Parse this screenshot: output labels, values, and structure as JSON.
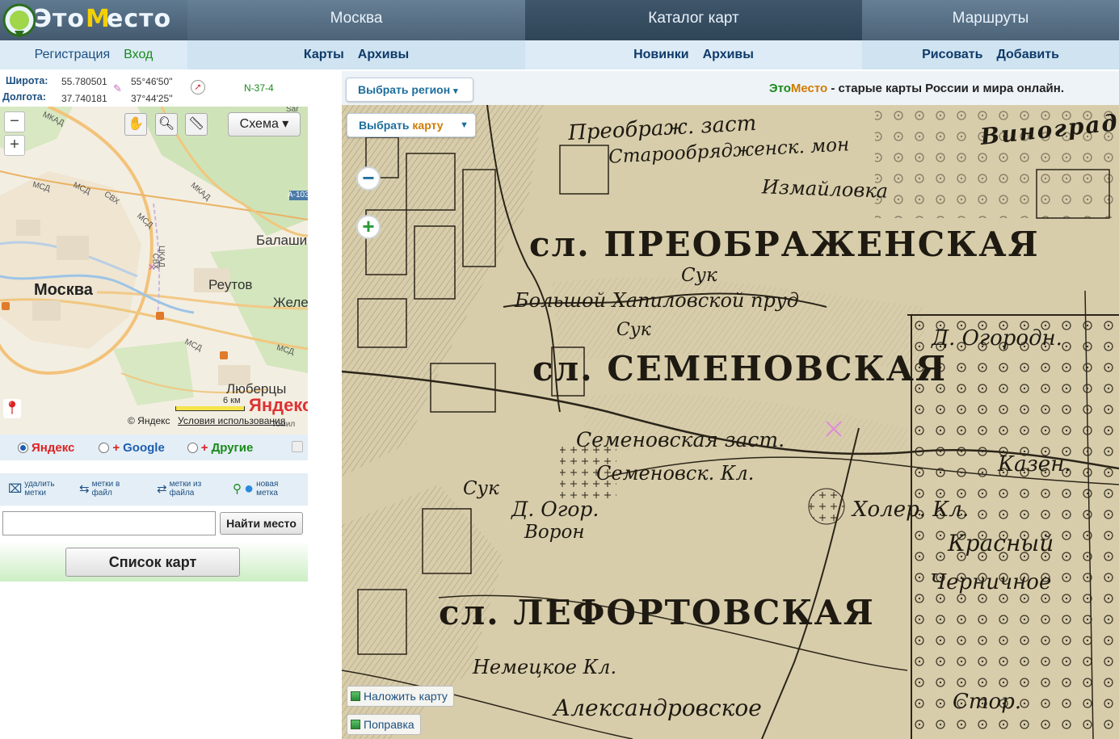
{
  "logo": {
    "text_eto": "Это",
    "text_m": "М",
    "text_esto": "есто"
  },
  "nav": {
    "tabs": [
      "Москва",
      "Каталог карт",
      "Маршруты"
    ]
  },
  "subnav": {
    "account": [
      "Регистрация",
      "Вход"
    ],
    "moscow": [
      "Карты",
      "Архивы"
    ],
    "catalog": [
      "Новинки",
      "Архивы"
    ],
    "routes": [
      "Рисовать",
      "Добавить"
    ]
  },
  "coords": {
    "lat_label": "Широта:",
    "lat_value": "55.780501",
    "lat_dms": "55°46'50''",
    "lon_label": "Долгота:",
    "lon_value": "37.740181",
    "lon_dms": "37°44'25''",
    "sheet": "N-37-4"
  },
  "minimap": {
    "mode": "Схема",
    "labels": {
      "moscow": "Москва",
      "reutov": "Реутов",
      "balashikha": "Балаши",
      "zhel": "Желе",
      "lyubertsy": "Люберцы"
    },
    "road_labels": [
      "МКАД",
      "МКАД",
      "МСД",
      "МСД",
      "СВХ",
      "МСД",
      "СВХ",
      "МСД",
      "МСД",
      "А-103",
      "Sar",
      "ЦКАД",
      "Томил"
    ],
    "scale": "6 км",
    "brand": "Яндекс",
    "copyright": "© Яндекс",
    "terms": "Условия использования"
  },
  "providers": [
    {
      "label": "Яндекс",
      "selected": true,
      "plus": false
    },
    {
      "label": "Google",
      "selected": false,
      "plus": true
    },
    {
      "label": "Другие",
      "selected": false,
      "plus": true
    }
  ],
  "marks_tools": [
    {
      "line1": "удалить",
      "line2": "метки",
      "icon": "delete-marks-icon"
    },
    {
      "line1": "метки в",
      "line2": "файл",
      "icon": "marks-to-file-icon"
    },
    {
      "line1": "метки из",
      "line2": "файла",
      "icon": "marks-from-file-icon"
    },
    {
      "line1": "новая",
      "line2": "метка",
      "icon": "new-mark-icon"
    }
  ],
  "search": {
    "value": "",
    "button": "Найти место"
  },
  "list_button": "Список карт",
  "map_header": {
    "region_button": "Выбрать регион",
    "tagline_eto": "Это",
    "tagline_mesto": "Место",
    "tagline_rest": " - старые карты России и мира онлайн."
  },
  "map": {
    "choose_a": "Выбрать ",
    "choose_b": "карту",
    "overlay_button": "Наложить карту",
    "fix_button": "Поправка",
    "labels": {
      "preobrazh_zast": "Преображ. заст",
      "staroobr": "Старообрядженск. мон",
      "izmailovka": "Измайловка",
      "vinograd": "Виноград",
      "preobr_caps": "сл. ПРЕОБРАЖЕНСКАЯ",
      "suk1": "Сук",
      "bolsh_prud": "Большой Хапиловской пруд",
      "suk2": "Сук",
      "ogorod": "Д. Огородн.",
      "semen_caps": "сл. СЕМЕНОВСКАЯ",
      "semen_zast": "Семеновская заст.",
      "semen_kl": "Семеновск. Кл.",
      "kazen": "Казен.",
      "suk3": "Сук",
      "ogor": "Д. Огор.",
      "voron": "Ворон",
      "holer": "Холер. Кл.",
      "krasnyi": "Красный",
      "chernichnoe": "Черничное",
      "lefort_caps": "сл. ЛЕФОРТОВСКАЯ",
      "nemetskoe": "Немецкое Кл.",
      "aleksandr": "Александровское",
      "stor": "Стор."
    }
  },
  "colors": {
    "accent_green": "#1a8a1a",
    "accent_orange": "#d07b00",
    "nav_blue": "#3b536a",
    "link_blue": "#1d4f80"
  }
}
